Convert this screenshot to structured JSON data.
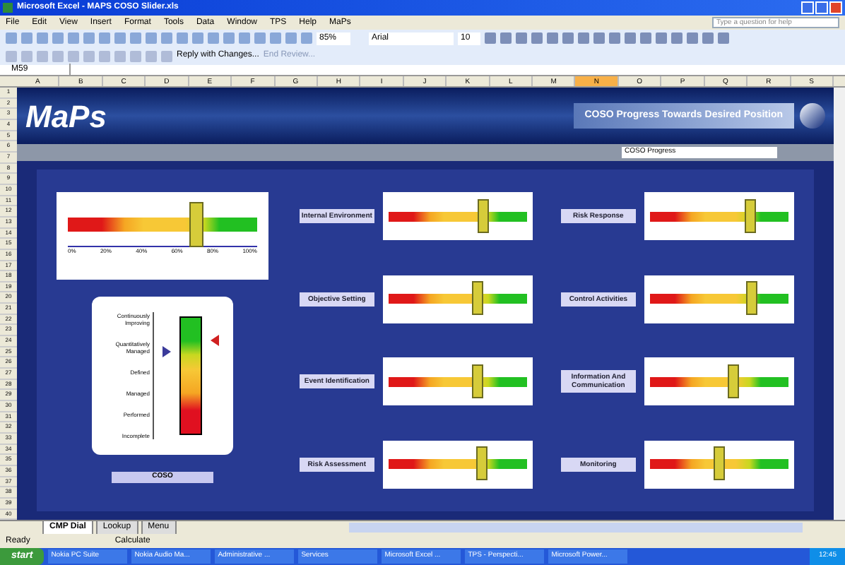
{
  "window": {
    "title": "Microsoft Excel - MAPS COSO Slider.xls"
  },
  "menu": [
    "File",
    "Edit",
    "View",
    "Insert",
    "Format",
    "Tools",
    "Data",
    "Window",
    "TPS",
    "Help",
    "MaPs"
  ],
  "help_box": {
    "placeholder": "Type a question for help"
  },
  "toolbar": {
    "zoom": "85%",
    "font": "Arial",
    "size": "10"
  },
  "review_toolbar": {
    "reply": "Reply with Changes...",
    "end": "End Review..."
  },
  "formula_bar": {
    "name_box": "M59"
  },
  "columns": [
    {
      "label": "A",
      "selected": false
    },
    {
      "label": "B",
      "selected": false
    },
    {
      "label": "C",
      "selected": false
    },
    {
      "label": "D",
      "selected": false
    },
    {
      "label": "E",
      "selected": false
    },
    {
      "label": "F",
      "selected": false
    },
    {
      "label": "G",
      "selected": false
    },
    {
      "label": "H",
      "selected": false
    },
    {
      "label": "I",
      "selected": false
    },
    {
      "label": "J",
      "selected": false
    },
    {
      "label": "K",
      "selected": false
    },
    {
      "label": "L",
      "selected": false
    },
    {
      "label": "M",
      "selected": false
    },
    {
      "label": "N",
      "selected": true
    },
    {
      "label": "O",
      "selected": false
    },
    {
      "label": "P",
      "selected": false
    },
    {
      "label": "Q",
      "selected": false
    },
    {
      "label": "R",
      "selected": false
    },
    {
      "label": "S",
      "selected": false
    }
  ],
  "rows": [
    "1",
    "2",
    "3",
    "4",
    "5",
    "6",
    "7",
    "8",
    "9",
    "10",
    "11",
    "12",
    "13",
    "14",
    "15",
    "16",
    "17",
    "18",
    "19",
    "20",
    "21",
    "22",
    "23",
    "24",
    "25",
    "26",
    "27",
    "28",
    "29",
    "30",
    "31",
    "32",
    "33",
    "34",
    "35",
    "36",
    "37",
    "38",
    "39",
    "40"
  ],
  "sheet": {
    "logo": "MaPs",
    "heading": "COSO Progress Towards Desired Position",
    "dropdown": "COSO Progress",
    "overall": {
      "level": 0.68,
      "ticks": [
        "0%",
        "20%",
        "40%",
        "60%",
        "80%",
        "100%"
      ]
    },
    "scale": {
      "labels": [
        "Continuously Improving",
        "Quantitatively Managed",
        "Defined",
        "Managed",
        "Performed",
        "Incomplete"
      ],
      "caption": "COSO"
    },
    "components": [
      {
        "label": "Internal Environment",
        "level": 0.68
      },
      {
        "label": "Risk Response",
        "level": 0.73
      },
      {
        "label": "Objective Setting",
        "level": 0.64
      },
      {
        "label": "Control Activities",
        "level": 0.74
      },
      {
        "label": "Event Identification",
        "level": 0.64
      },
      {
        "label": "Information And Communication",
        "level": 0.6
      },
      {
        "label": "Risk Assessment",
        "level": 0.67
      },
      {
        "label": "Monitoring",
        "level": 0.5
      }
    ]
  },
  "sheet_tabs": [
    {
      "label": "CMP Dial",
      "selected": true
    },
    {
      "label": "Lookup",
      "selected": false
    },
    {
      "label": "Menu",
      "selected": false
    }
  ],
  "status_bar": [
    "Ready",
    "Calculate"
  ],
  "taskbar": {
    "start": "start",
    "items": [
      "Nokia PC Suite",
      "Nokia Audio Ma...",
      "Administrative ...",
      "Services",
      "Microsoft Excel ...",
      "TPS - Perspecti...",
      "Microsoft Power..."
    ],
    "clock": "12:45"
  }
}
